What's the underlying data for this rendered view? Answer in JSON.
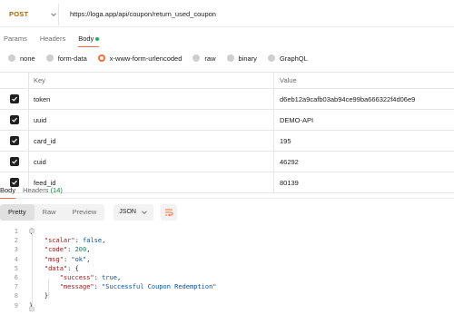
{
  "request": {
    "method": "POST",
    "url": "https://loga.app/api/coupon/return_used_coupon",
    "tabs": [
      "Params",
      "Headers",
      "Body"
    ],
    "active_tab": "Body",
    "body_types": [
      "none",
      "form-data",
      "x-www-form-urlencoded",
      "raw",
      "binary",
      "GraphQL"
    ],
    "selected_body_type": "x-www-form-urlencoded"
  },
  "table": {
    "headers": [
      "Key",
      "Value"
    ],
    "rows": [
      {
        "key": "token",
        "value": "d6eb12a9cafb03ab94ce99ba666322f4d06e9",
        "checked": true
      },
      {
        "key": "uuid",
        "value": "DEMO-API",
        "checked": true
      },
      {
        "key": "card_id",
        "value": "195",
        "checked": true
      },
      {
        "key": "cuid",
        "value": "46292",
        "checked": true
      },
      {
        "key": "feed_id",
        "value": "80139",
        "checked": true
      }
    ]
  },
  "response": {
    "tabs": [
      "Body",
      "Headers"
    ],
    "headers_count": "(14)",
    "views": [
      "Pretty",
      "Raw",
      "Preview"
    ],
    "active_view": "Pretty",
    "format": "JSON",
    "line_numbers": [
      "1",
      "2",
      "3",
      "4",
      "5",
      "6",
      "7",
      "8",
      "9"
    ]
  },
  "json_body": {
    "scalar_key": "\"scalar\"",
    "scalar_val": "false",
    "code_key": "\"code\"",
    "code_val": "200",
    "msg_key": "\"msg\"",
    "msg_val": "\"ok\"",
    "data_key": "\"data\"",
    "success_key": "\"success\"",
    "success_val": "true",
    "message_key": "\"message\"",
    "message_val": "\"Successful Coupon Redemption\""
  },
  "colors": {
    "accent": "#ff6c37",
    "method": "#a8670a",
    "json_key": "#a31515",
    "json_keyword": "#0451a5",
    "json_number": "#098658"
  }
}
